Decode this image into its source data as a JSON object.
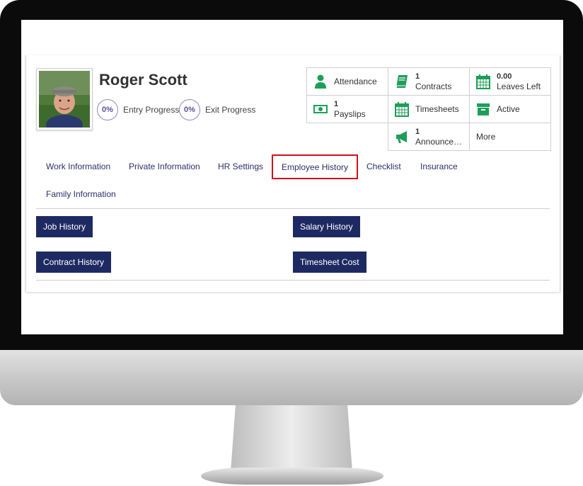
{
  "profile": {
    "name": "Roger Scott",
    "entry_progress_value": "0%",
    "entry_progress_label": "Entry Progress",
    "exit_progress_value": "0%",
    "exit_progress_label": "Exit Progress"
  },
  "tiles": {
    "attendance": {
      "label": "Attendance",
      "icon": "person-icon",
      "color": "#1e9e5a"
    },
    "contracts": {
      "count": "1",
      "label": "Contracts",
      "icon": "book-icon",
      "color": "#1e9e5a"
    },
    "leaves": {
      "count": "0.00",
      "label": "Leaves Left",
      "icon": "calendar-icon",
      "color": "#1e9e5a"
    },
    "payslips": {
      "count": "1",
      "label": "Payslips",
      "icon": "money-icon",
      "color": "#1e9e5a"
    },
    "timesheets": {
      "label": "Timesheets",
      "icon": "calendar-icon",
      "color": "#1e9e5a"
    },
    "status": {
      "label": "Active",
      "icon": "archive-icon",
      "color": "#1e9e5a"
    },
    "announcements": {
      "count": "1",
      "label": "Announceme…",
      "icon": "megaphone-icon",
      "color": "#1e9e5a"
    },
    "more": {
      "label": "More"
    }
  },
  "tabs": [
    {
      "label": "Work Information"
    },
    {
      "label": "Private Information"
    },
    {
      "label": "HR Settings"
    },
    {
      "label": "Employee History",
      "active": true
    },
    {
      "label": "Checklist"
    },
    {
      "label": "Insurance"
    },
    {
      "label": "Family Information"
    }
  ],
  "history_buttons": {
    "job_history": "Job History",
    "salary_history": "Salary History",
    "contract_history": "Contract History",
    "timesheet_cost": "Timesheet Cost"
  },
  "colors": {
    "accent_navy": "#1d2a62",
    "tab_text": "#2c2f6b",
    "active_tab_border": "#d0101a",
    "icon_green": "#1e9e5a"
  }
}
